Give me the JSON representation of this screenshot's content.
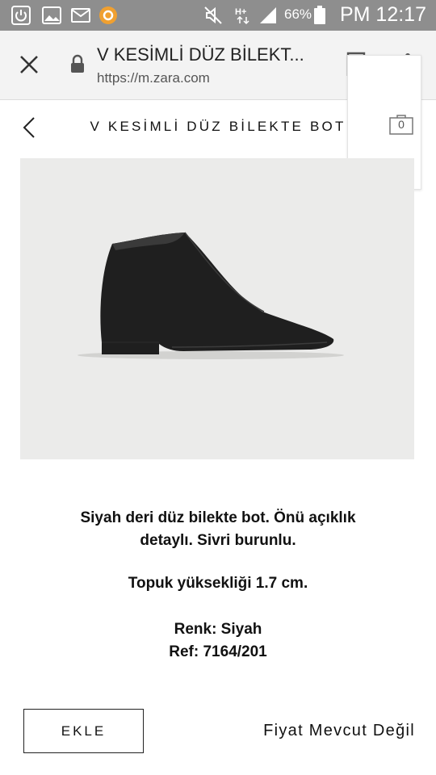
{
  "status_bar": {
    "battery": "66%",
    "clock": "PM 12:17",
    "icons": [
      "power-icon",
      "image-icon",
      "mail-icon",
      "app-notification-icon",
      "mute-icon",
      "data-network-icon",
      "signal-icon",
      "battery-icon"
    ]
  },
  "browser": {
    "title": "V KESİMLİ DÜZ BİLEKT...",
    "url": "https://m.zara.com",
    "icons": [
      "close-icon",
      "lock-icon",
      "bookmark-icon",
      "more-vert-icon"
    ]
  },
  "page": {
    "title": "V KESİMLİ DÜZ BİLEKTE BOT",
    "cart_count": "0"
  },
  "product": {
    "desc_line1": "Siyah deri düz bilekte bot. Önü açıklık",
    "desc_line2": "detaylı. Sivri burunlu.",
    "heel": "Topuk yüksekliği 1.7 cm.",
    "color": "Renk: Siyah",
    "ref": "Ref: 7164/201"
  },
  "actions": {
    "add_label": "EKLE",
    "price_status": "Fiyat Mevcut Değil"
  }
}
